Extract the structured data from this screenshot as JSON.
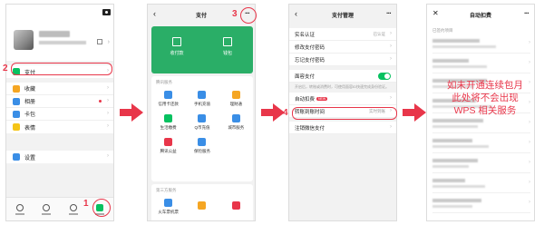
{
  "steps": [
    "1",
    "2",
    "3",
    "4"
  ],
  "phone1": {
    "menu": [
      {
        "label": "支付",
        "color": "#07c160"
      },
      {
        "label": "收藏",
        "color": "#f5a623"
      },
      {
        "label": "相册",
        "color": "#3a8ee6"
      },
      {
        "label": "卡包",
        "color": "#3a8ee6"
      },
      {
        "label": "表情",
        "color": "#f5c518"
      }
    ],
    "settings": {
      "label": "设置",
      "color": "#3a8ee6"
    },
    "tabs": [
      "微信",
      "通讯录",
      "发现",
      "我"
    ]
  },
  "phone2": {
    "title": "支付",
    "pay": {
      "collect": "收付款",
      "wallet": "钱包"
    },
    "tencent_header": "腾讯服务",
    "tencent_services": [
      {
        "label": "信用卡还款",
        "color": "#3a8ee6"
      },
      {
        "label": "手机充值",
        "color": "#3a8ee6"
      },
      {
        "label": "理财通",
        "color": "#f5a623"
      },
      {
        "label": "生活缴费",
        "color": "#07c160"
      },
      {
        "label": "Q币充值",
        "color": "#3a8ee6"
      },
      {
        "label": "城市服务",
        "color": "#3a8ee6"
      },
      {
        "label": "腾讯公益",
        "color": "#e8364a"
      },
      {
        "label": "保险服务",
        "color": "#3a8ee6"
      }
    ],
    "third_header": "第三方服务",
    "third_services": [
      {
        "label": "火车票机票",
        "color": "#3a8ee6"
      },
      {
        "label": "",
        "color": "#f5a623"
      },
      {
        "label": "",
        "color": "#e8364a"
      }
    ]
  },
  "phone3": {
    "title": "支付管理",
    "rows": [
      {
        "label": "实名认证",
        "value": "已认证"
      },
      {
        "label": "修改支付密码",
        "value": ""
      },
      {
        "label": "忘记支付密码",
        "value": ""
      }
    ],
    "face_pay": "面容支付",
    "face_hint": "开启后，转账或消费时，可使用面容ID快速完成身份验证。",
    "auto_row": {
      "label": "自动扣费",
      "badge": "NEW"
    },
    "transfer_row": {
      "label": "转账到账时间",
      "value": "实时到账"
    },
    "cancel_row": {
      "label": "注销微信支付",
      "value": ""
    }
  },
  "phone4": {
    "title": "自动扣费",
    "section": "已签约项目",
    "note": "如未开通连续包月此处将不会出现 WPS 相关服务"
  }
}
